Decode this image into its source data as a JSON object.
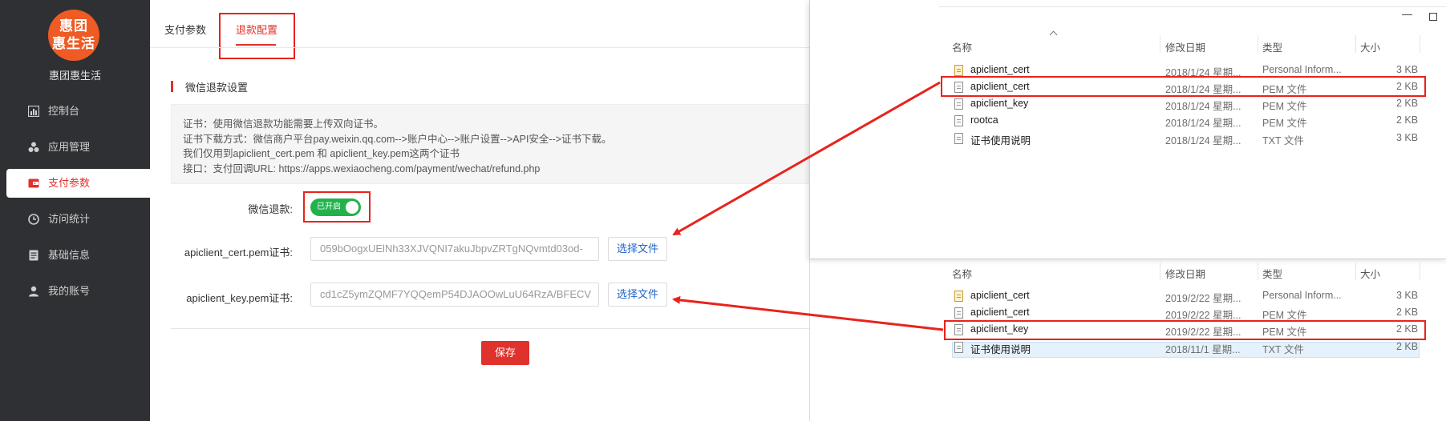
{
  "sidebar": {
    "logo_text": "惠团\n惠生活",
    "app_name": "惠团惠生活",
    "items": [
      {
        "label": "控制台",
        "icon": "dashboard-icon"
      },
      {
        "label": "应用管理",
        "icon": "apps-icon"
      },
      {
        "label": "支付参数",
        "icon": "wallet-icon",
        "active": true
      },
      {
        "label": "访问统计",
        "icon": "clock-icon"
      },
      {
        "label": "基础信息",
        "icon": "document-icon"
      },
      {
        "label": "我的账号",
        "icon": "user-icon"
      }
    ]
  },
  "tabs": [
    {
      "label": "支付参数"
    },
    {
      "label": "退款配置",
      "active": true
    }
  ],
  "section": {
    "title": "微信退款设置",
    "info": [
      "证书：使用微信退款功能需要上传双向证书。",
      "证书下载方式：微信商户平台pay.weixin.qq.com-->账户中心-->账户设置-->API安全-->证书下载。",
      "我们仅用到apiclient_cert.pem 和 apiclient_key.pem这两个证书",
      "接口：支付回调URL: https://apps.wexiaocheng.com/payment/wechat/refund.php"
    ]
  },
  "form": {
    "refund_label": "微信退款:",
    "toggle_text": "已开启",
    "toggle_on": true,
    "cert_label": "apiclient_cert.pem证书:",
    "cert_value": "059bOogxUElNh33XJVQNI7akuJbpvZRTgNQvmtd03od-",
    "key_label": "apiclient_key.pem证书:",
    "key_value": "cd1cZ5ymZQMF7YQQemP54DJAOOwLuU64RzA/BFECV",
    "choose_file": "选择文件",
    "save": "保存"
  },
  "explorer1": {
    "headers": [
      "名称",
      "修改日期",
      "类型",
      "大小"
    ],
    "rows": [
      {
        "name": "apiclient_cert",
        "date": "2018/1/24 星期...",
        "type": "Personal Inform...",
        "size": "3 KB",
        "icon": "certificate-file-icon"
      },
      {
        "name": "apiclient_cert",
        "date": "2018/1/24 星期...",
        "type": "PEM 文件",
        "size": "2 KB",
        "icon": "file-icon"
      },
      {
        "name": "apiclient_key",
        "date": "2018/1/24 星期...",
        "type": "PEM 文件",
        "size": "2 KB",
        "icon": "file-icon"
      },
      {
        "name": "rootca",
        "date": "2018/1/24 星期...",
        "type": "PEM 文件",
        "size": "2 KB",
        "icon": "file-icon"
      },
      {
        "name": "证书使用说明",
        "date": "2018/1/24 星期...",
        "type": "TXT 文件",
        "size": "3 KB",
        "icon": "text-file-icon"
      }
    ]
  },
  "explorer2": {
    "headers": [
      "名称",
      "修改日期",
      "类型",
      "大小"
    ],
    "rows": [
      {
        "name": "apiclient_cert",
        "date": "2019/2/22 星期...",
        "type": "Personal Inform...",
        "size": "3 KB",
        "icon": "certificate-file-icon"
      },
      {
        "name": "apiclient_cert",
        "date": "2019/2/22 星期...",
        "type": "PEM 文件",
        "size": "2 KB",
        "icon": "file-icon"
      },
      {
        "name": "apiclient_key",
        "date": "2019/2/22 星期...",
        "type": "PEM 文件",
        "size": "2 KB",
        "icon": "file-icon"
      },
      {
        "name": "证书使用说明",
        "date": "2018/11/1 星期...",
        "type": "TXT 文件",
        "size": "2 KB",
        "icon": "text-file-icon"
      }
    ]
  },
  "colors": {
    "sidebar_bg": "#2f3033",
    "accent_red": "#e0322c",
    "annotation_red": "#e8231c",
    "toggle_green": "#23b14d",
    "link_blue": "#1f63c8"
  }
}
